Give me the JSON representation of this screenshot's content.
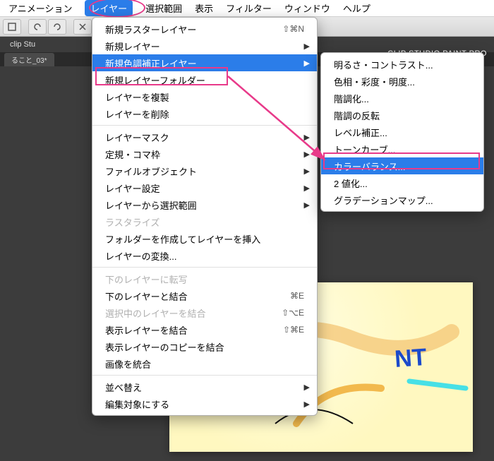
{
  "menubar": {
    "items": [
      "アニメーション",
      "レイヤー",
      "選択範囲",
      "表示",
      "フィルター",
      "ウィンドウ",
      "ヘルプ"
    ],
    "active_index": 1
  },
  "titlebar": {
    "left": "clip Stu",
    "right": "CLIP STUDIO PAINT PRO"
  },
  "tab": {
    "label": "ること_03*"
  },
  "layer_menu": {
    "items": [
      {
        "label": "新規ラスターレイヤー",
        "shortcut": "⇧⌘N"
      },
      {
        "label": "新規レイヤー",
        "submenu": true
      },
      {
        "label": "新規色調補正レイヤー",
        "submenu": true,
        "highlight": true
      },
      {
        "label": "新規レイヤーフォルダー"
      },
      {
        "label": "レイヤーを複製"
      },
      {
        "label": "レイヤーを削除"
      },
      {
        "divider": true
      },
      {
        "label": "レイヤーマスク",
        "submenu": true
      },
      {
        "label": "定規・コマ枠",
        "submenu": true
      },
      {
        "label": "ファイルオブジェクト",
        "submenu": true
      },
      {
        "label": "レイヤー設定",
        "submenu": true
      },
      {
        "label": "レイヤーから選択範囲",
        "submenu": true
      },
      {
        "label": "ラスタライズ",
        "disabled": true
      },
      {
        "label": "フォルダーを作成してレイヤーを挿入"
      },
      {
        "label": "レイヤーの変換..."
      },
      {
        "divider": true
      },
      {
        "label": "下のレイヤーに転写",
        "disabled": true
      },
      {
        "label": "下のレイヤーと結合",
        "shortcut": "⌘E"
      },
      {
        "label": "選択中のレイヤーを結合",
        "shortcut": "⇧⌥E",
        "disabled": true
      },
      {
        "label": "表示レイヤーを結合",
        "shortcut": "⇧⌘E"
      },
      {
        "label": "表示レイヤーのコピーを結合"
      },
      {
        "label": "画像を統合"
      },
      {
        "divider": true
      },
      {
        "label": "並べ替え",
        "submenu": true
      },
      {
        "label": "編集対象にする",
        "submenu": true
      }
    ]
  },
  "submenu": {
    "items": [
      {
        "label": "明るさ・コントラスト..."
      },
      {
        "label": "色相・彩度・明度..."
      },
      {
        "label": "階調化..."
      },
      {
        "label": "階調の反転"
      },
      {
        "label": "レベル補正..."
      },
      {
        "label": "トーンカーブ..."
      },
      {
        "label": "カラーバランス...",
        "highlight": true
      },
      {
        "label": "2 値化..."
      },
      {
        "label": "グラデーションマップ..."
      }
    ]
  }
}
